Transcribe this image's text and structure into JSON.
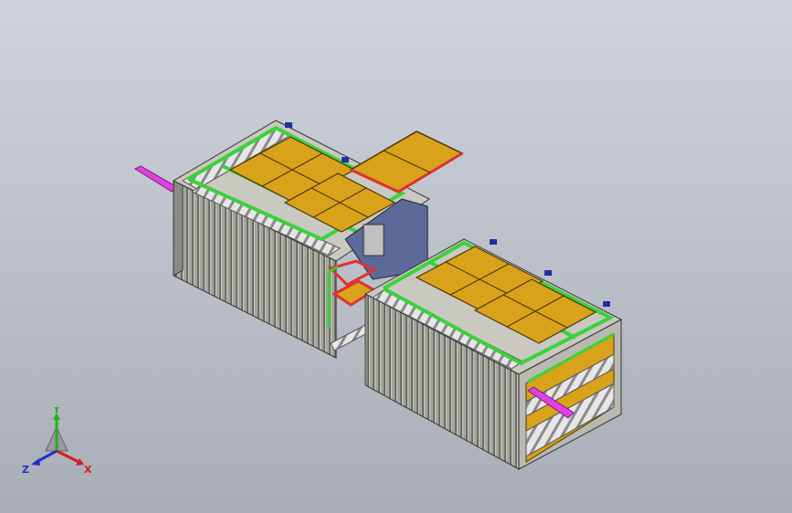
{
  "window": {
    "title": ""
  },
  "triad": {
    "x_label": "X",
    "y_label": "Y",
    "z_label": "Z",
    "colors": {
      "x": "#d02020",
      "y": "#20b020",
      "z": "#2030d0"
    }
  },
  "palette": {
    "background_top": "#cfd3dc",
    "background_bottom": "#a9adb6",
    "container_wall": "#9a9b92",
    "frame_green": "#3ad23a",
    "panel_yellow": "#d9a21b",
    "frame_red": "#e03030",
    "pipe_magenta": "#e040e0",
    "door_blue": "#5c6a9a",
    "roller_grey": "#d8d8d8"
  }
}
